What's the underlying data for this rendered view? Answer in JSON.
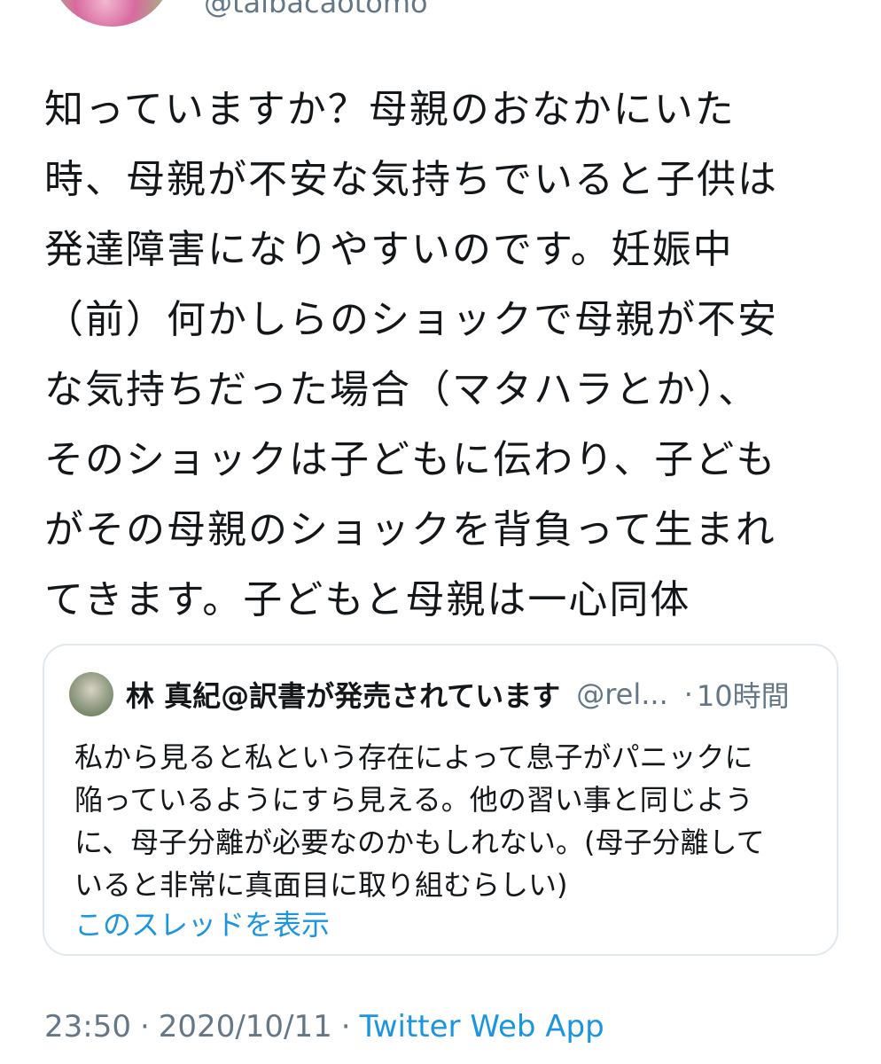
{
  "author": {
    "handle_partial": "@taibacaotomo"
  },
  "tweet": {
    "lines": [
      "知っていますか？母親のおなかにいた",
      "時、母親が不安な気持ちでいると子供は",
      "発達障害になりやすいのです。妊娠中",
      "（前）何かしらのショックで母親が不安",
      "な気持ちだった場合（マタハラとか）、",
      "そのショックは子どもに伝わり、子ども",
      "がその母親のショックを背負って生まれ",
      "てきます。子どもと母親は一心同体"
    ]
  },
  "quote": {
    "name": "林 真紀@訳書が発売されています",
    "handle": "@rel...",
    "dot": "·",
    "time": "10時間",
    "lines": [
      "私から見ると私という存在によって息子がパニックに",
      "陥っているようにすら見える。他の習い事と同じよう",
      "に、母子分離が必要なのかもしれない。(母子分離して",
      "いると非常に真面目に取り組むらしい)"
    ],
    "show_thread": "このスレッドを表示"
  },
  "meta": {
    "time": "23:50",
    "sep1": "·",
    "date": "2020/10/11",
    "sep2": "·",
    "app": "Twitter Web App"
  }
}
